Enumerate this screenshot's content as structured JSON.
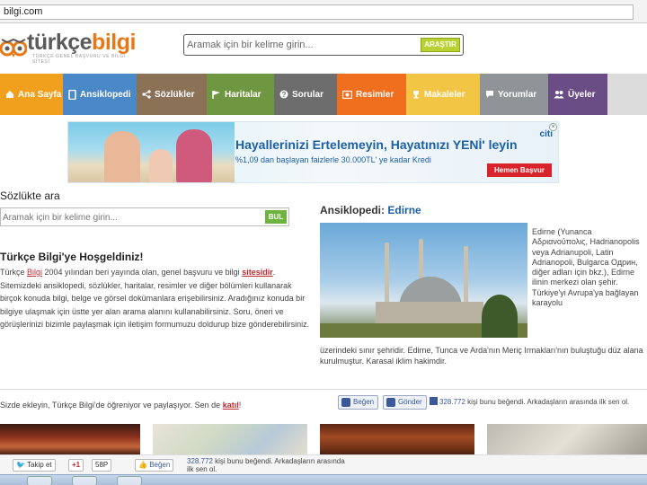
{
  "browser": {
    "url": "bilgi.com"
  },
  "header": {
    "logo_primary": "türkçe",
    "logo_secondary": "bilgi",
    "logo_tagline": "TÜRKÇE GENEL BAŞVURU VE BİLGİ SİTESİ",
    "search_placeholder": "Aramak için bir kelime girin...",
    "search_button": "ARAŞTIR"
  },
  "nav": {
    "items": [
      {
        "label": "Ana Sayfa",
        "icon": "home-icon",
        "color": "#f0a01c"
      },
      {
        "label": "Ansiklopedi",
        "icon": "book-icon",
        "color": "#4b88c7"
      },
      {
        "label": "Sözlükler",
        "icon": "share-icon",
        "color": "#8b7257"
      },
      {
        "label": "Haritalar",
        "icon": "flag-icon",
        "color": "#6f9640"
      },
      {
        "label": "Sorular",
        "icon": "question-icon",
        "color": "#6d6d6d"
      },
      {
        "label": "Resimler",
        "icon": "image-icon",
        "color": "#f06f1e"
      },
      {
        "label": "Makaleler",
        "icon": "trophy-icon",
        "color": "#f3c545"
      },
      {
        "label": "Yorumlar",
        "icon": "comment-icon",
        "color": "#909497"
      },
      {
        "label": "Üyeler",
        "icon": "users-icon",
        "color": "#6b4d86"
      }
    ]
  },
  "ad": {
    "headline": "Hayallerinizi Ertelemeyin, Hayatınızı YENİ' leyin",
    "subline": "%1,09 dan başlayan faizlerle 30.000TL' ye kadar Kredi",
    "cta": "Hemen Başvur",
    "brand": "citi"
  },
  "dictionary": {
    "title": "Sözlükte ara",
    "placeholder": "Aramak için bir kelime girin...",
    "button": "BUL"
  },
  "welcome": {
    "title": "Türkçe Bilgi'ye Hoşgeldiniz!",
    "p_before": "Türkçe ",
    "p_link1": "Bilgi",
    "p_mid": " 2004 yılından beri yayında olan, genel başvuru ve bilgi ",
    "p_link2": "sitesidir",
    "p_after": ". Sitemizdeki ansiklopedi, sözlükler, haritalar, resimler ve diğer bölümleri kullanarak birçok konuda bilgi, belge ve görsel dokümanlara erişebilirsiniz. Aradığınız konuda bir bilgiye ulaşmak için üstte yer alan arama alanını kullanabilirsiniz. Soru, öneri ve görüşlerinizi bizimle paylaşmak için iletişim formumuzu doldurup bize gönderebilirsiniz."
  },
  "encyclopedia": {
    "label": "Ansiklopedi:",
    "topic": "Edirne",
    "side_text": "Edirne (Yunanca Αδριανούπολις, Hadrianopolis veya Adrianupoli, Latin Adrianopoli, Bulgarca Одрин, diğer adları için bkz.), Edirne ilinin merkezi olan şehir. Türkiye'yi Avrupa'ya bağlayan karayolu",
    "bottom_text": "üzerindeki sınır şehridir. Edirne, Tunca ve Arda'nın Meriç Irmakları'nın buluştuğu düz alana kurulmuştur. Karasal iklim hakimdir."
  },
  "social": {
    "join_text": "Sizde ekleyin, Türkçe Bilgi'de öğreniyor ve paylaşıyor. Sen de ",
    "join_link": "katıl",
    "join_end": "!",
    "like_button": "Beğen",
    "send_button": "Gönder",
    "like_count": "328.772",
    "like_text": "kişi bunu beğendi. Arkadaşların arasında ilk sen ol."
  },
  "sharebar": {
    "tweet": "Takip et",
    "gplus": "+1",
    "gplus_count": "58P",
    "like": "Beğen",
    "count": "328.772",
    "text_1": " kişi bunu beğendi. Arkadaşların arasında",
    "text_2": "ilk sen ol."
  }
}
